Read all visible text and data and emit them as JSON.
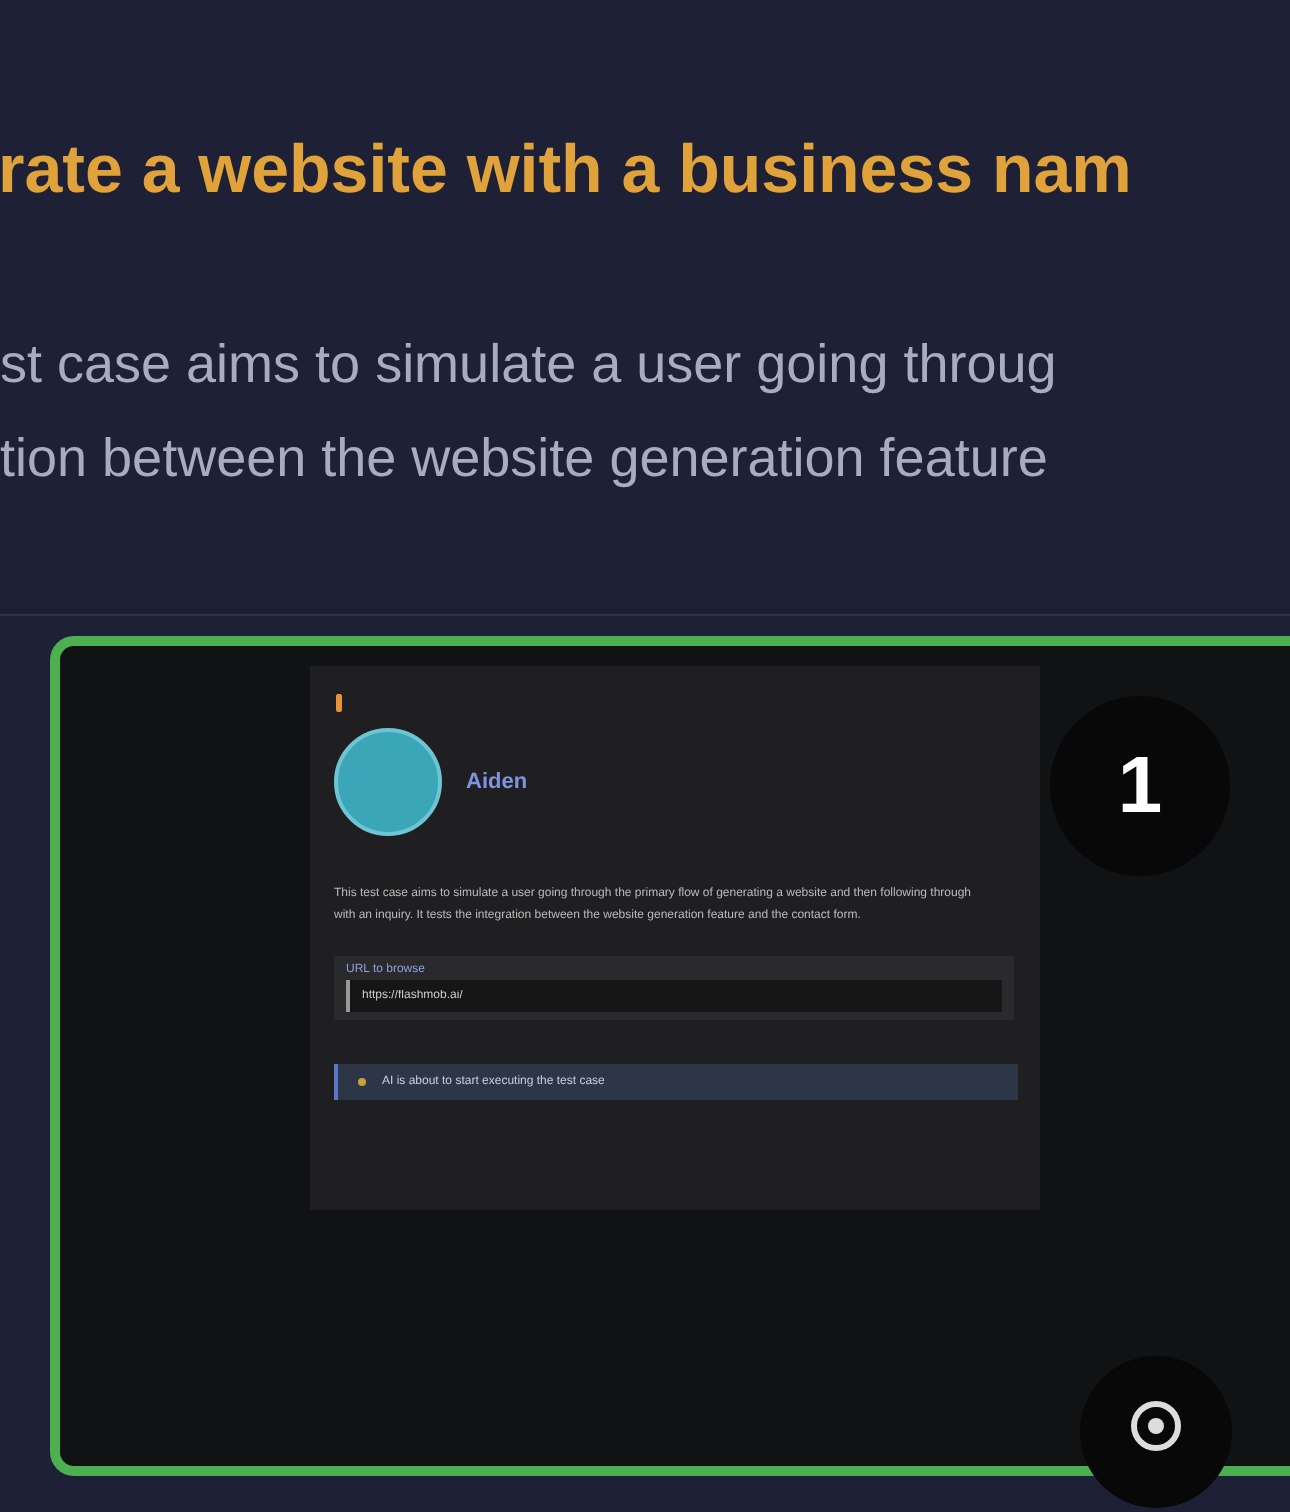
{
  "heading": "rate a website with a business nam",
  "description": [
    "st case aims to simulate a user going throug",
    "tion between the website generation feature"
  ],
  "preview": {
    "profile_name": "Aiden",
    "summary": "This test case aims to simulate a user going through the primary flow of generating a website and then following through with an inquiry. It tests the integration between the website generation feature and the contact form.",
    "url_field": {
      "label": "URL to browse",
      "value": "https://flashmob.ai/"
    },
    "status": "AI is about to start executing the test case"
  },
  "step_badge": "1"
}
